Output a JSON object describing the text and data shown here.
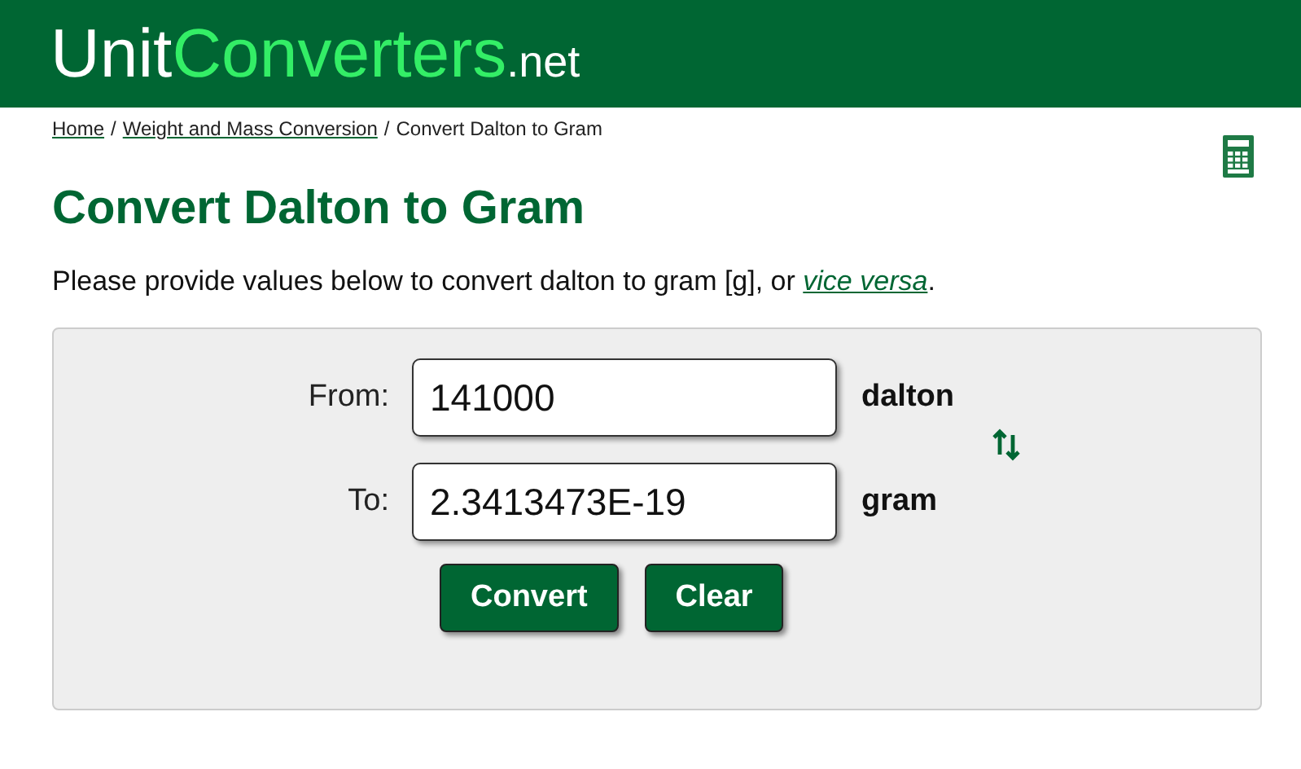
{
  "logo": {
    "unit": "Unit",
    "converters": "Converters",
    "tld": ".net"
  },
  "breadcrumb_separator": "/",
  "breadcrumb": [
    {
      "label": "Home",
      "link": true
    },
    {
      "label": "Weight and Mass Conversion",
      "link": true
    },
    {
      "label": "Convert Dalton to Gram",
      "link": false
    }
  ],
  "title": "Convert Dalton to Gram",
  "intro": {
    "before": "Please provide values below to convert dalton to gram [g], or ",
    "link": "vice versa",
    "after": "."
  },
  "form": {
    "rows": [
      {
        "label": "From:",
        "value": "141000",
        "unit": "dalton"
      },
      {
        "label": "To:",
        "value": "2.3413473E-19",
        "unit": "gram"
      }
    ],
    "buttons": [
      "Convert",
      "Clear"
    ]
  }
}
